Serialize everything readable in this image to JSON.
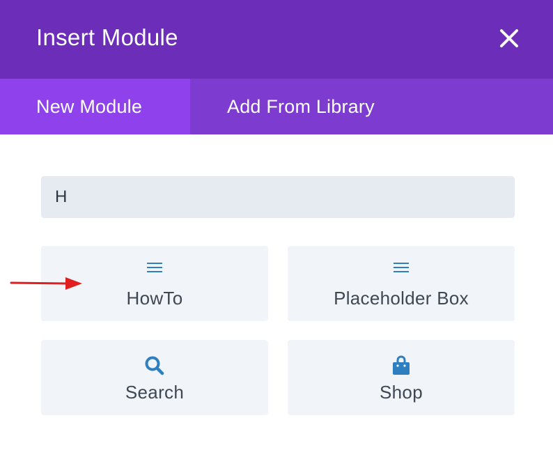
{
  "header": {
    "title": "Insert Module"
  },
  "tabs": [
    {
      "label": "New Module",
      "active": true
    },
    {
      "label": "Add From Library",
      "active": false
    }
  ],
  "search": {
    "value": "H"
  },
  "modules": [
    {
      "label": "HowTo",
      "icon": "menu-icon"
    },
    {
      "label": "Placeholder Box",
      "icon": "menu-icon"
    },
    {
      "label": "Search",
      "icon": "search-icon"
    },
    {
      "label": "Shop",
      "icon": "shopping-bag-icon"
    }
  ],
  "colors": {
    "header": "#6c2eb9",
    "tab_bar": "#7d3bcf",
    "tab_active": "#8f42ec",
    "icon_blue": "#2e7fbf",
    "annotation_arrow": "#e02020"
  }
}
